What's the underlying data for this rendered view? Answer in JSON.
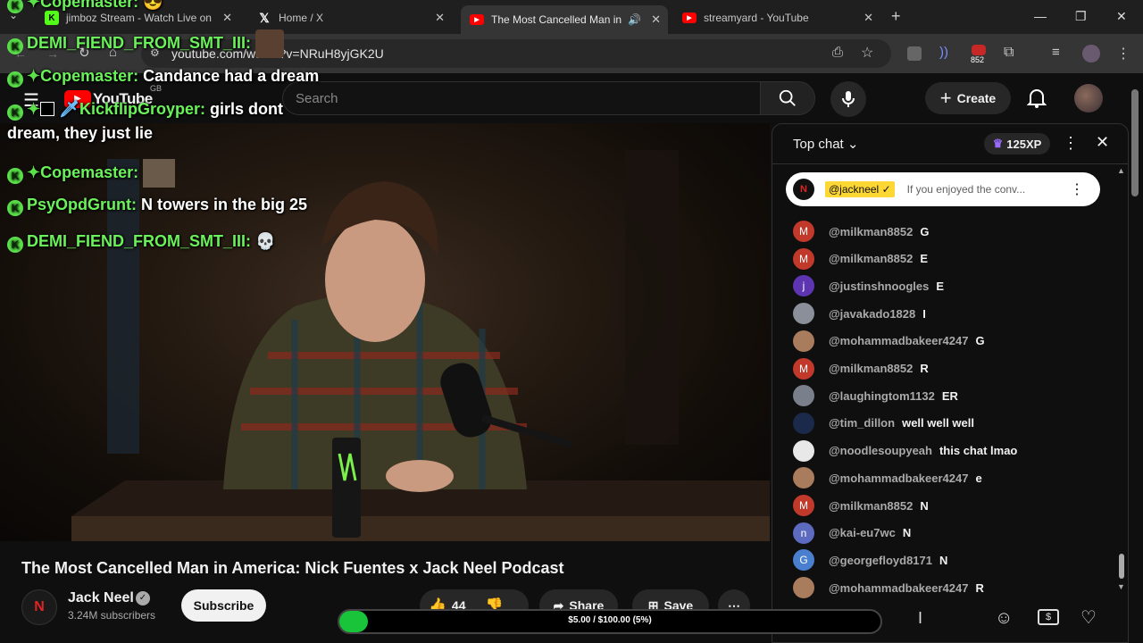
{
  "browser": {
    "tabs": [
      {
        "title": "jimboz Stream - Watch Live on",
        "favicon": "kick-icon"
      },
      {
        "title": "Home / X",
        "favicon": "x-icon"
      },
      {
        "title": "The Most Cancelled Man in",
        "favicon": "youtube-icon",
        "active": true
      },
      {
        "title": "streamyard - YouTube",
        "favicon": "youtube-icon"
      }
    ],
    "url": "youtube.com/watch?v=NRuH8yjGK2U",
    "extension_badge": "852"
  },
  "youtube": {
    "logo": "YouTube",
    "region": "GB",
    "search_placeholder": "Search",
    "create_label": "Create"
  },
  "overlay_chat": [
    {
      "name": "Copemaster:",
      "text": ""
    },
    {
      "name": "DEMI_FIEND_FROM_SMT_III:",
      "text": ""
    },
    {
      "name": "Copemaster:",
      "text": "Candance had a dream"
    },
    {
      "name": "KickflipGroyper:",
      "text": "girls dont"
    },
    {
      "name": "",
      "text": "dream, they just lie"
    },
    {
      "name": "Copemaster:",
      "text": ""
    },
    {
      "name": "PsyOpdGrunt:",
      "text": "N towers in the big 25"
    },
    {
      "name": "DEMI_FIEND_FROM_SMT_III:",
      "text": ""
    }
  ],
  "video": {
    "title": "The Most Cancelled Man in America: Nick Fuentes x Jack Neel Podcast",
    "channel": "Jack Neel",
    "subscribers": "3.24M subscribers",
    "subscribe_label": "Subscribe",
    "likes": "44",
    "share_label": "Share",
    "save_label": "Save"
  },
  "chat": {
    "mode": "Top chat",
    "xp": "125XP",
    "pinned": {
      "author": "@jackneel",
      "text": "If you enjoyed the conv..."
    },
    "messages": [
      {
        "author": "@milkman8852",
        "text": "G",
        "avatar": "M",
        "color": "#c0392b"
      },
      {
        "author": "@milkman8852",
        "text": "E",
        "avatar": "M",
        "color": "#c0392b"
      },
      {
        "author": "@justinshnoogles",
        "text": "E",
        "avatar": "j",
        "color": "#5e35b1"
      },
      {
        "author": "@javakado1828",
        "text": "I",
        "avatar": "",
        "color": "#8a8f99"
      },
      {
        "author": "@mohammadbakeer4247",
        "text": "G",
        "avatar": "",
        "color": "#a97c5d"
      },
      {
        "author": "@milkman8852",
        "text": "R",
        "avatar": "M",
        "color": "#c0392b"
      },
      {
        "author": "@laughingtom1132",
        "text": "ER",
        "avatar": "",
        "color": "#7a7f8c"
      },
      {
        "author": "@tim_dillon",
        "text": "well well well",
        "avatar": "",
        "color": "#1b2a4a"
      },
      {
        "author": "@noodlesoupyeah",
        "text": "this chat lmao",
        "avatar": "",
        "color": "#e8e8e8"
      },
      {
        "author": "@mohammadbakeer4247",
        "text": "e",
        "avatar": "",
        "color": "#a97c5d"
      },
      {
        "author": "@milkman8852",
        "text": "N",
        "avatar": "M",
        "color": "#c0392b"
      },
      {
        "author": "@kai-eu7wc",
        "text": "N",
        "avatar": "n",
        "color": "#5c6bc0"
      },
      {
        "author": "@georgefloyd8171",
        "text": "N",
        "avatar": "G",
        "color": "#4a7fd0"
      },
      {
        "author": "@mohammadbakeer4247",
        "text": "R",
        "avatar": "",
        "color": "#a97c5d"
      }
    ]
  },
  "goal": {
    "text": "$5.00 / $100.00 (5%)",
    "progress": 0.05
  }
}
